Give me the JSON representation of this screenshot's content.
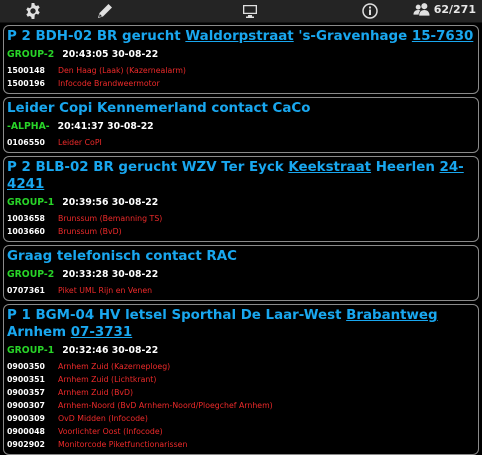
{
  "toolbar": {
    "icons": [
      "gear-icon",
      "pencil-icon",
      "monitor-icon",
      "info-icon",
      "users-icon"
    ],
    "user_count": "62/271"
  },
  "messages": [
    {
      "title": [
        {
          "t": "P 2 BDH-02 BR gerucht "
        },
        {
          "t": "Waldorpstraat",
          "link": true
        },
        {
          "t": " 's-Gravenhage "
        },
        {
          "t": "15-7630",
          "link": true
        }
      ],
      "group": "GROUP-2",
      "time": "20:43:05 30-08-22",
      "capcodes": [
        {
          "code": "1500148",
          "desc": "Den Haag (Laak) (Kazernealarm)"
        },
        {
          "code": "1500196",
          "desc": "Infocode Brandweermotor"
        }
      ]
    },
    {
      "title": [
        {
          "t": "Leider Copi Kennemerland contact CaCo"
        }
      ],
      "group": "-ALPHA-",
      "time": "20:41:37 30-08-22",
      "capcodes": [
        {
          "code": "0106550",
          "desc": "Leider CoPI"
        }
      ]
    },
    {
      "title": [
        {
          "t": "P 2 BLB-02 BR gerucht WZV Ter Eyck "
        },
        {
          "t": "Keekstraat",
          "link": true
        },
        {
          "t": " Heerlen "
        },
        {
          "t": "24-4241",
          "link": true
        }
      ],
      "group": "GROUP-1",
      "time": "20:39:56 30-08-22",
      "capcodes": [
        {
          "code": "1003658",
          "desc": "Brunssum (Bemanning TS)"
        },
        {
          "code": "1003660",
          "desc": "Brunssum (BvD)"
        }
      ]
    },
    {
      "title": [
        {
          "t": "Graag telefonisch contact RAC"
        }
      ],
      "group": "GROUP-2",
      "time": "20:33:28 30-08-22",
      "capcodes": [
        {
          "code": "0707361",
          "desc": "Piket UML Rijn en Venen"
        }
      ]
    },
    {
      "title": [
        {
          "t": "P 1 BGM-04 HV letsel Sporthal De Laar-West "
        },
        {
          "t": "Brabantweg",
          "link": true
        },
        {
          "t": " Arnhem "
        },
        {
          "t": "07-3731",
          "link": true
        }
      ],
      "group": "GROUP-1",
      "time": "20:32:46 30-08-22",
      "capcodes": [
        {
          "code": "0900350",
          "desc": "Arnhem Zuid (Kazerneploeg)"
        },
        {
          "code": "0900351",
          "desc": "Arnhem Zuid (Lichtkrant)"
        },
        {
          "code": "0900357",
          "desc": "Arnhem Zuid (BvD)"
        },
        {
          "code": "0900307",
          "desc": "Arnhem-Noord (BvD Arnhem-Noord/Ploegchef Arnhem)"
        },
        {
          "code": "0900309",
          "desc": "OvD Midden (Infocode)"
        },
        {
          "code": "0900048",
          "desc": "Voorlichter Oost (Infocode)"
        },
        {
          "code": "0902902",
          "desc": "Monitorcode Piketfunctionarissen"
        }
      ]
    }
  ]
}
